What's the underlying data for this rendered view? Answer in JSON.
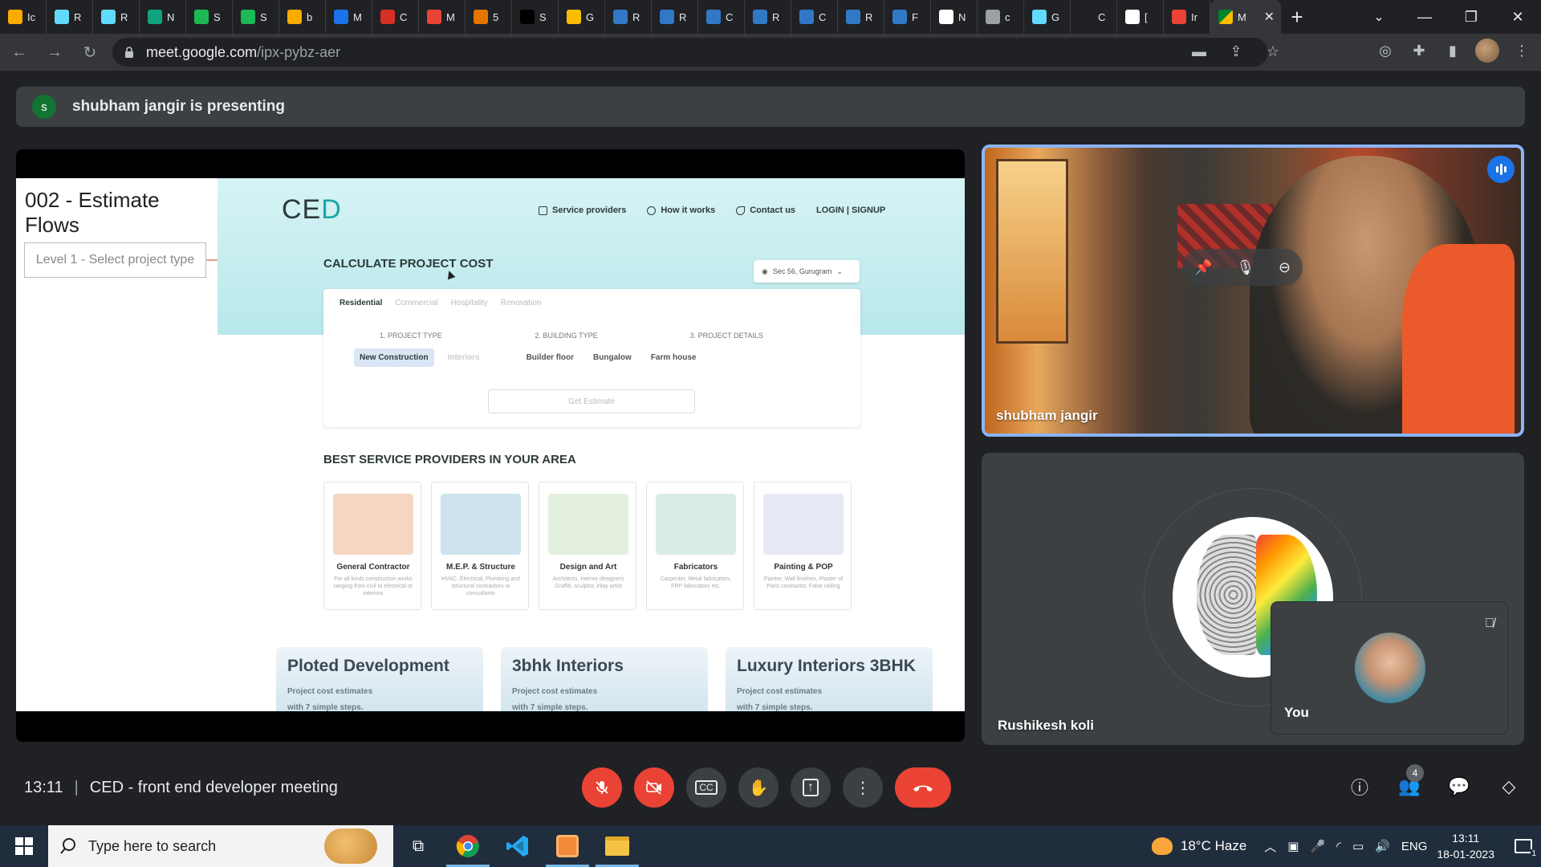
{
  "browser": {
    "tabs": [
      {
        "label": "Ic",
        "color": "#f9ab00"
      },
      {
        "label": "R",
        "color": "#61dafb"
      },
      {
        "label": "R",
        "color": "#61dafb"
      },
      {
        "label": "N",
        "color": "#10a37f"
      },
      {
        "label": "S",
        "color": "#1db954"
      },
      {
        "label": "S",
        "color": "#1db954"
      },
      {
        "label": "b",
        "color": "#f9ab00"
      },
      {
        "label": "M",
        "color": "#1a73e8"
      },
      {
        "label": "C",
        "color": "#d93025"
      },
      {
        "label": "M",
        "color": "#ea4335"
      },
      {
        "label": "5",
        "color": "#e37400"
      },
      {
        "label": "S",
        "color": "#000000"
      },
      {
        "label": "G",
        "color": "#fbbc04"
      },
      {
        "label": "R",
        "color": "#3178c6"
      },
      {
        "label": "R",
        "color": "#3178c6"
      },
      {
        "label": "C",
        "color": "#3178c6"
      },
      {
        "label": "R",
        "color": "#3178c6"
      },
      {
        "label": "C",
        "color": "#3178c6"
      },
      {
        "label": "R",
        "color": "#3178c6"
      },
      {
        "label": "F",
        "color": "#3178c6"
      },
      {
        "label": "N",
        "color": "#ffffff"
      },
      {
        "label": "c",
        "color": "#9aa0a6"
      },
      {
        "label": "G",
        "color": "#61dafb"
      },
      {
        "label": "C",
        "color": "#202124"
      },
      {
        "label": "[",
        "color": "#ffffff"
      },
      {
        "label": "Ir",
        "color": "#ea4335"
      }
    ],
    "active_tab": {
      "label": "M",
      "close": "✕"
    },
    "new_tab": "+",
    "url_host": "meet.google.com",
    "url_path": "/ipx-pybz-aer"
  },
  "meet": {
    "presenter_initial": "s",
    "presenting_text": "shubham jangir is presenting",
    "meeting_time": "13:11",
    "meeting_title": "CED - front end developer meeting",
    "participants_count": "4",
    "tiles": {
      "main_name": "shubham jangir",
      "second_name": "Rushikesh koli",
      "self_label": "You"
    }
  },
  "slide": {
    "title": "002 - Estimate Flows",
    "level_box": "Level 1 - Select project type",
    "site": {
      "logo": "CE",
      "logo_accent": "D",
      "nav": [
        "Service providers",
        "How it works",
        "Contact us",
        "LOGIN | SIGNUP"
      ],
      "calc_title": "CALCULATE PROJECT COST",
      "location": "Sec 56, Gurugram",
      "tabs": [
        "Residential",
        "Commercial",
        "Hospitality",
        "Renovation"
      ],
      "steps": [
        "1. PROJECT TYPE",
        "2. BUILDING TYPE",
        "3. PROJECT DETAILS"
      ],
      "chips": [
        "New Construction",
        "Interiors",
        "Builder floor",
        "Bungalow",
        "Farm house"
      ],
      "get_estimate": "Get Estimate",
      "best_title": "BEST SERVICE PROVIDERS IN YOUR AREA",
      "providers": [
        {
          "name": "General Contractor",
          "desc": "For all kinds construction works ranging from civil to electrical or interiors",
          "color": "#f4d6c2"
        },
        {
          "name": "M.E.P. & Structure",
          "desc": "HVAC, Electrical, Plumbing and structural contractors or consultants",
          "color": "#cfe3ee"
        },
        {
          "name": "Design and Art",
          "desc": "Architects, Interior designers Graffiti, sculptor, inlay artist",
          "color": "#e4f0df"
        },
        {
          "name": "Fabricators",
          "desc": "Carpenter, Metal fabricators, FRP fabricators etc.",
          "color": "#d9ece8"
        },
        {
          "name": "Painting & POP",
          "desc": "Painter, Wall finishes, Plaster of Paris contractor, False ceiling",
          "color": "#e6eaf4"
        }
      ],
      "bottom_cards": [
        {
          "title": "Ploted Development",
          "l1": "Project cost estimates",
          "l2": "with 7 simple steps."
        },
        {
          "title": "3bhk Interiors",
          "l1": "Project cost estimates",
          "l2": "with 7 simple steps."
        },
        {
          "title": "Luxury Interiors 3BHK",
          "l1": "Project cost estimates",
          "l2": "with 7 simple steps."
        }
      ]
    }
  },
  "taskbar": {
    "search_placeholder": "Type here to search",
    "weather": "18°C  Haze",
    "lang": "ENG",
    "time": "13:11",
    "date": "18-01-2023",
    "notif_count": "1"
  }
}
